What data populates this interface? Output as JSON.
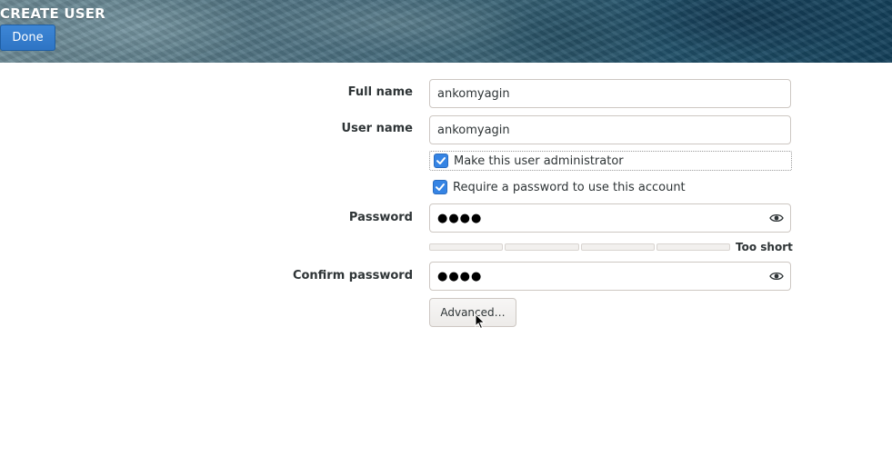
{
  "header": {
    "title": "CREATE USER",
    "done_label": "Done"
  },
  "form": {
    "full_name": {
      "label": "Full name",
      "value": "ankomyagin"
    },
    "user_name": {
      "label": "User name",
      "value": "ankomyagin"
    },
    "admin_checkbox": {
      "label": "Make this user administrator",
      "checked": true
    },
    "require_password_checkbox": {
      "label": "Require a password to use this account",
      "checked": true
    },
    "password": {
      "label": "Password",
      "masked_value": "●●●●",
      "icon": "eye-icon"
    },
    "strength": {
      "label": "Too short",
      "level": 0,
      "segments": 4
    },
    "confirm_password": {
      "label": "Confirm password",
      "masked_value": "●●●●",
      "icon": "eye-icon"
    },
    "advanced_label": "Advanced…"
  },
  "colors": {
    "accent": "#3584e4",
    "done_button": "#2e74c4",
    "text": "#2e3436"
  }
}
